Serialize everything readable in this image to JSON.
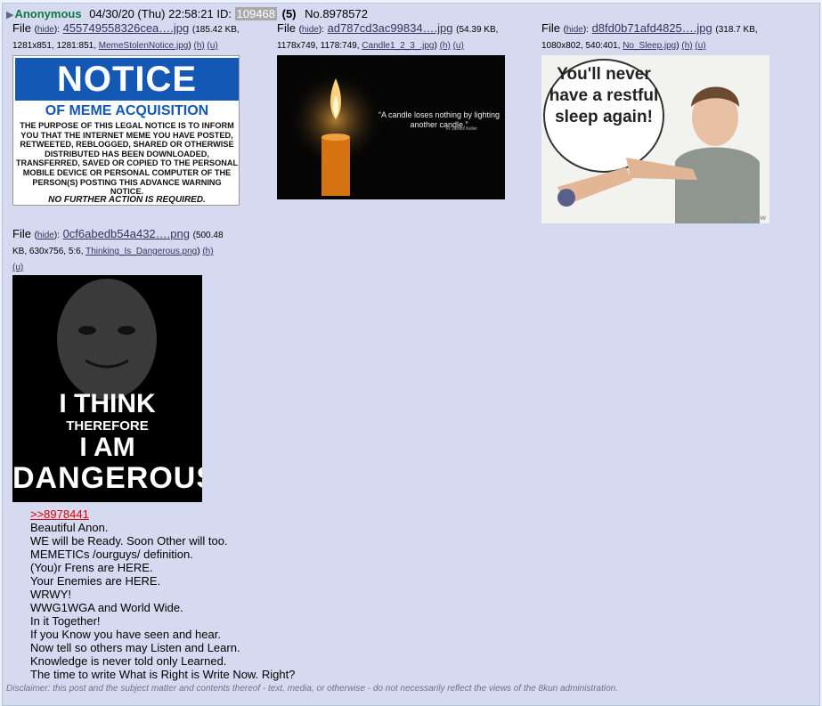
{
  "post": {
    "name": "Anonymous",
    "datetime": "04/30/20 (Thu) 22:58:21",
    "id_label": "ID:",
    "poster_id": "109468",
    "reply_count": "(5)",
    "post_number": "No.8978572"
  },
  "common": {
    "file_label": "File",
    "hide_label": "hide",
    "h_label": "(h)",
    "u_label": "(u)"
  },
  "files": [
    {
      "filename": "455749558326cea….jpg",
      "meta": "185.42 KB, 1281x851, 1281:851,",
      "original_name": "MemeStolenNotice.jpg",
      "thumb_text": {
        "head": "NOTICE",
        "sub": "OF MEME ACQUISITION",
        "body": "THE PURPOSE OF THIS LEGAL NOTICE IS TO INFORM YOU THAT THE INTERNET MEME YOU HAVE POSTED, RETWEETED, REBLOGGED, SHARED OR OTHERWISE DISTRIBUTED HAS BEEN DOWNLOADED, TRANSFERRED, SAVED OR COPIED TO THE PERSONAL MOBILE DEVICE OR PERSONAL COMPUTER OF THE PERSON(S) POSTING THIS ADVANCE WARNING NOTICE.",
        "foot": "NO FURTHER ACTION IS REQUIRED."
      }
    },
    {
      "filename": "ad787cd3ac99834….jpg",
      "meta": "54.39 KB, 1178x749, 1178:749,",
      "original_name": "Candle1_2_3_.jpg",
      "thumb_text": {
        "quote": "“A candle loses nothing by lighting another candle.”",
        "author": "Fr James Keller"
      }
    },
    {
      "filename": "d8fd0b71afd4825….jpg",
      "meta": "318.7 KB, 1080x802, 540:401,",
      "original_name": "No_Sleep.jpg",
      "thumb_text": {
        "bubble": "You'll never have a restful sleep again!",
        "watermark": "wikiHow"
      }
    },
    {
      "filename": "0cf6abedb54a432….png",
      "meta_line1": "500.48",
      "meta_line2": "KB, 630x756, 5:6,",
      "original_name": "Thinking_Is_Dangerous.png",
      "thumb_text": {
        "line1": "I THINK",
        "line2": "THEREFORE",
        "line3": "I AM",
        "line4": "DANGEROUS"
      }
    }
  ],
  "body": {
    "quote_link": ">>8978441",
    "lines": [
      "Beautiful Anon.",
      "WE will be Ready. Soon Other will too.",
      "MEMETICs /ourguys/ definition.",
      "(You)r Frens are HERE.",
      "Your Enemies are HERE.",
      "WRWY!",
      "WWG1WGA and World Wide.",
      "In it Together!",
      "If you Know you have seen and hear.",
      "Now tell so others may Listen and Learn.",
      "Knowledge is never told only Learned.",
      "The time to write What is Right is Write Now. Right?"
    ]
  },
  "disclaimer": "Disclaimer: this post and the subject matter and contents thereof - text, media, or otherwise - do not necessarily reflect the views of the 8kun administration."
}
